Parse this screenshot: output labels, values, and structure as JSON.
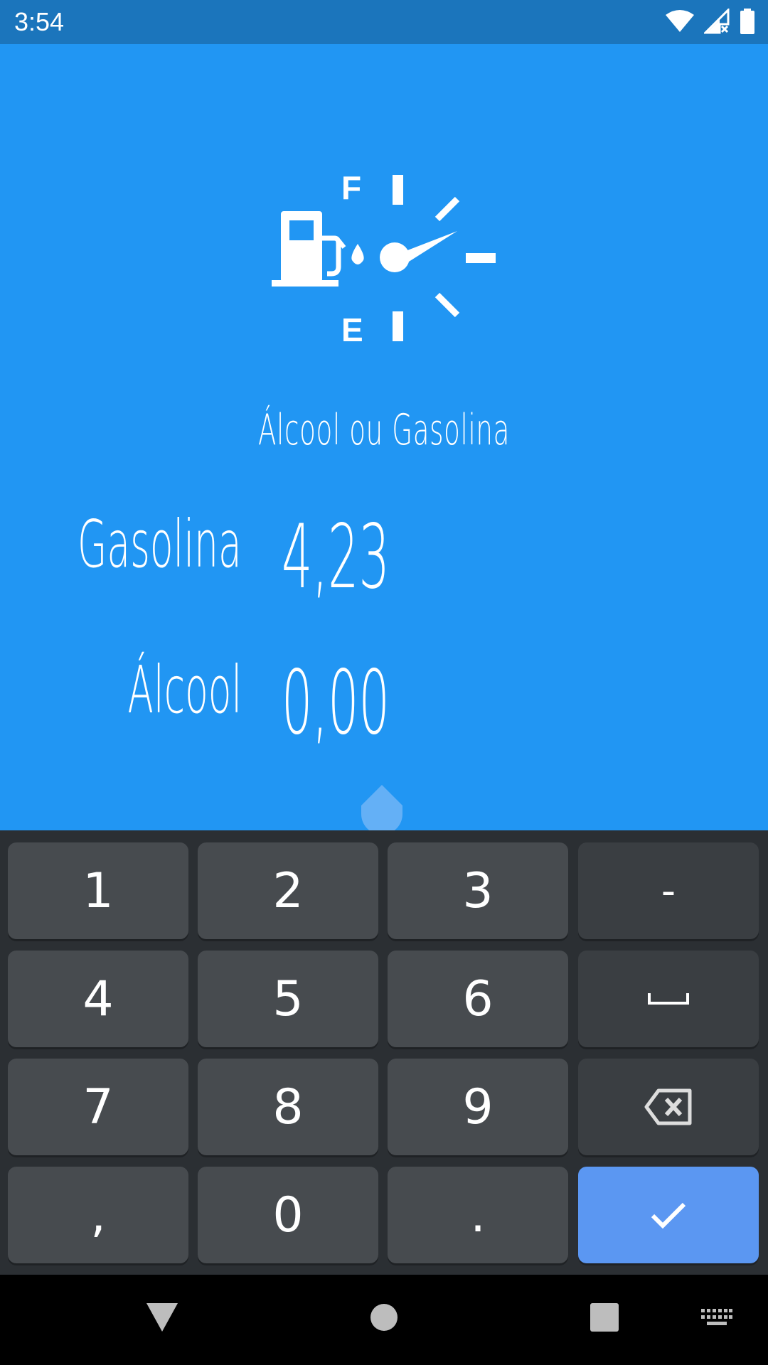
{
  "status_bar": {
    "time": "3:54",
    "icons": [
      "wifi-icon",
      "cell-signal-icon",
      "battery-icon"
    ]
  },
  "app": {
    "title": "Álcool ou Gasolina",
    "logo_icon": "fuel-gauge-icon",
    "gauge_labels": {
      "full": "F",
      "empty": "E"
    },
    "fields": [
      {
        "label": "Gasolina",
        "value": "4,23"
      },
      {
        "label": "Álcool",
        "value": "0,00"
      }
    ]
  },
  "keyboard": {
    "rows": [
      [
        "1",
        "2",
        "3",
        "-"
      ],
      [
        "4",
        "5",
        "6",
        "space"
      ],
      [
        "7",
        "8",
        "9",
        "backspace"
      ],
      [
        ",",
        "0",
        ".",
        "done"
      ]
    ],
    "labels": {
      "k1": "1",
      "k2": "2",
      "k3": "3",
      "minus": "-",
      "k4": "4",
      "k5": "5",
      "k6": "6",
      "space": "␣",
      "k7": "7",
      "k8": "8",
      "k9": "9",
      "comma": ",",
      "k0": "0",
      "period": "."
    }
  },
  "nav_bar": {
    "icons": [
      "back-icon",
      "home-icon",
      "recents-icon",
      "keyboard-switch-icon"
    ]
  },
  "colors": {
    "background": "#2196F3",
    "status_bar": "#1B75BC",
    "keyboard": "#2B2F33",
    "key": "#474B4F",
    "key_action": "#5B97F2"
  }
}
